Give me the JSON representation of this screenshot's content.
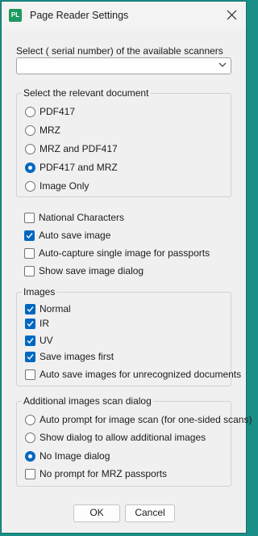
{
  "window": {
    "title": "Page Reader Settings",
    "icon_text": "PL"
  },
  "scanner": {
    "label": "Select ( serial number) of  the available scanners",
    "value": ""
  },
  "document": {
    "caption": "Select the relevant document",
    "options": [
      {
        "label": "PDF417",
        "selected": false
      },
      {
        "label": "MRZ",
        "selected": false
      },
      {
        "label": "MRZ and PDF417",
        "selected": false
      },
      {
        "label": "PDF417 and MRZ",
        "selected": true
      },
      {
        "label": "Image Only",
        "selected": false
      }
    ]
  },
  "flags": [
    {
      "label": "National Characters",
      "checked": false
    },
    {
      "label": "Auto save image",
      "checked": true
    },
    {
      "label": "Auto-capture single image for passports",
      "checked": false
    },
    {
      "label": "Show save image dialog",
      "checked": false
    }
  ],
  "images": {
    "caption": "Images",
    "options": [
      {
        "label": "Normal",
        "checked": true
      },
      {
        "label": "IR",
        "checked": true
      },
      {
        "label": "UV",
        "checked": true
      },
      {
        "label": "Save images first",
        "checked": true
      },
      {
        "label": "Auto save images for unrecognized documents",
        "checked": false
      }
    ]
  },
  "additional": {
    "caption": "Additional images scan dialog",
    "options": [
      {
        "label": "Auto prompt for image scan (for one-sided scans)",
        "type": "radio",
        "selected": false
      },
      {
        "label": "Show dialog to allow additional images",
        "type": "radio",
        "selected": false
      },
      {
        "label": "No Image dialog",
        "type": "radio",
        "selected": true
      },
      {
        "label": "No prompt for MRZ passports",
        "type": "checkbox",
        "selected": false
      }
    ]
  },
  "buttons": {
    "ok": "OK",
    "cancel": "Cancel"
  }
}
